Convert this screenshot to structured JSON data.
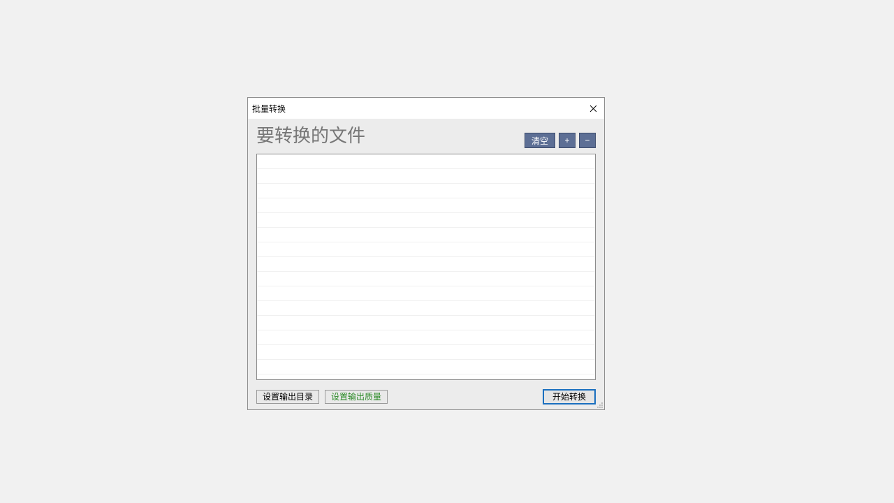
{
  "dialog": {
    "title": "批量转换",
    "heading": "要转换的文件",
    "header_buttons": {
      "clear": "清空",
      "add": "+",
      "remove": "−"
    },
    "footer": {
      "set_output_dir": "设置输出目录",
      "set_output_quality": "设置输出质量",
      "start": "开始转换"
    }
  }
}
